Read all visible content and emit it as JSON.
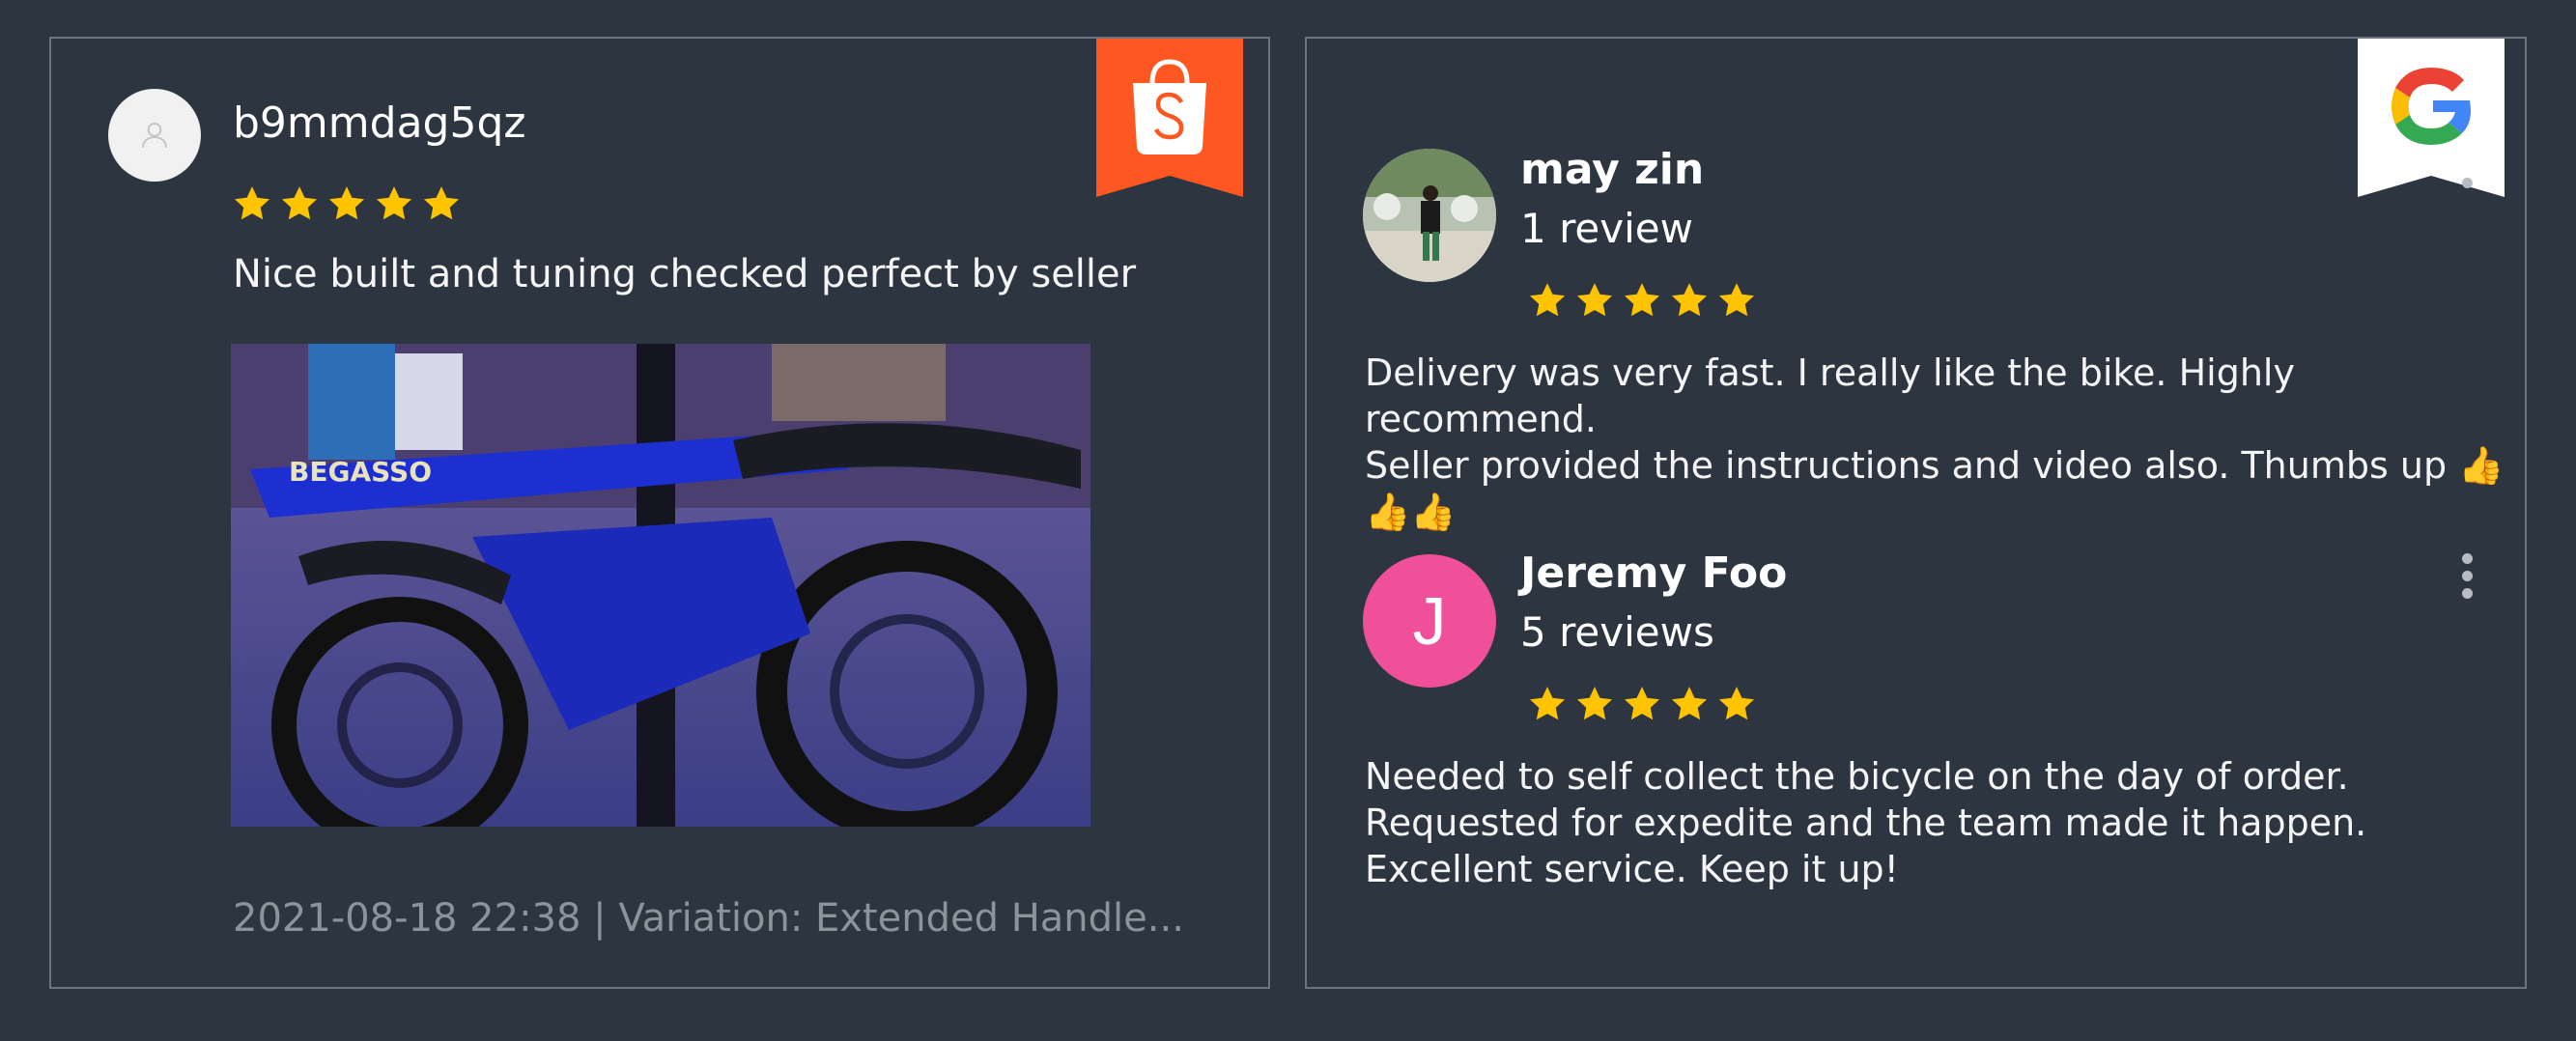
{
  "shopee_review": {
    "platform_icon": "shopee-bag-icon",
    "username": "b9mmdag5qz",
    "rating": 5,
    "text": "Nice built and tuning checked perfect by seller",
    "photo_brand_text": "BEGASSO",
    "meta": "2021-08-18 22:38 | Variation: Extended Handle..."
  },
  "google_reviews": {
    "platform_icon": "google-g-icon",
    "reviews": [
      {
        "name": "may zin",
        "review_count": "1 review",
        "rating": 5,
        "text_lines": [
          "Delivery was very fast. I really like the  bike. Highly recommend.",
          "Seller provided the instructions and video also. Thumbs up 👍👍👍"
        ]
      },
      {
        "name": "Jeremy Foo",
        "initial": "J",
        "review_count": "5 reviews",
        "rating": 5,
        "text_lines": [
          "Needed to self collect the bicycle on the day of order.",
          "Requested for expedite and the team made it happen.",
          "Excellent service. Keep it up!"
        ]
      }
    ]
  },
  "colors": {
    "background": "#2d3540",
    "card_border": "#6d7580",
    "star": "#ffc400",
    "shopee_orange": "#ff5722",
    "avatar_pink": "#f0509a",
    "meta_gray": "#8d939b"
  }
}
